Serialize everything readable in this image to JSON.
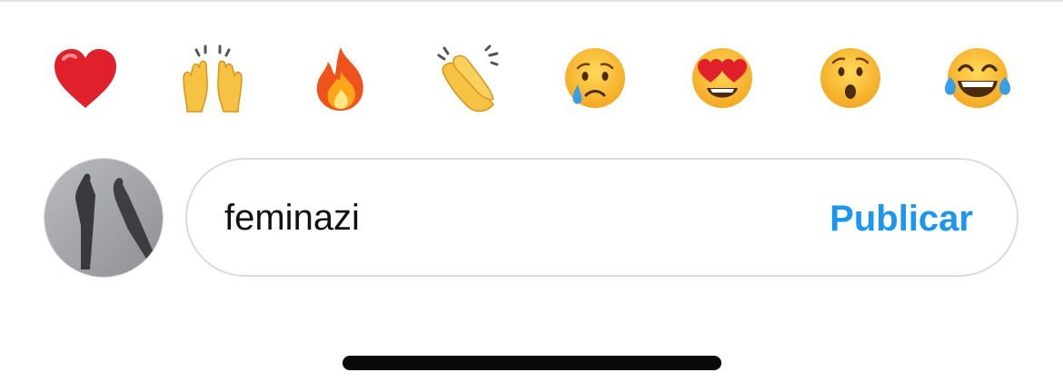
{
  "reactions": [
    {
      "icon": "red-heart-icon"
    },
    {
      "icon": "raising-hands-icon"
    },
    {
      "icon": "fire-icon"
    },
    {
      "icon": "clapping-hands-icon"
    },
    {
      "icon": "crying-face-icon"
    },
    {
      "icon": "heart-eyes-icon"
    },
    {
      "icon": "surprised-face-icon"
    },
    {
      "icon": "tears-of-joy-icon"
    }
  ],
  "composer": {
    "comment_value": "feminazi",
    "publish_label": "Publicar"
  },
  "colors": {
    "accent": "#1a96f0",
    "border": "#dbdbdb",
    "text": "#111111"
  }
}
